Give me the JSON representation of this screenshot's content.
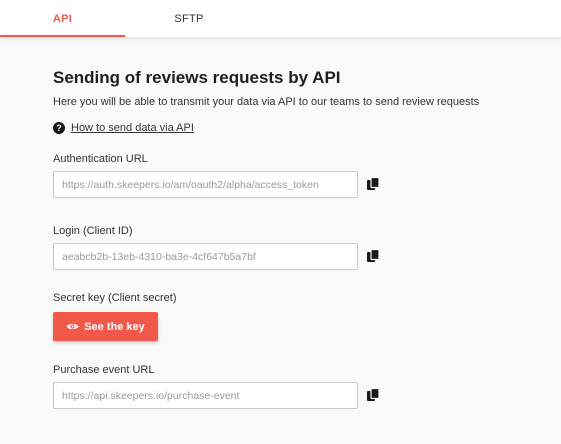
{
  "tabs": [
    {
      "label": "API",
      "active": true
    },
    {
      "label": "SFTP",
      "active": false
    }
  ],
  "section": {
    "title": "Sending of reviews requests by API",
    "subtitle": "Here you will be able to transmit your data via API to our teams to send review requests",
    "help_link": "How to send data via API"
  },
  "fields": {
    "auth_url": {
      "label": "Authentication URL",
      "value": "https://auth.skeepers.io/am/oauth2/alpha/access_token"
    },
    "login": {
      "label": "Login (Client ID)",
      "value": "aeabcb2b-13eb-4310-ba3e-4cf647b5a7bf"
    },
    "secret": {
      "label": "Secret key (Client secret)",
      "button": "See the key"
    },
    "purchase_url": {
      "label": "Purchase event URL",
      "value": "https://api.skeepers.io/purchase-event"
    }
  },
  "colors": {
    "accent": "#f2584a"
  }
}
